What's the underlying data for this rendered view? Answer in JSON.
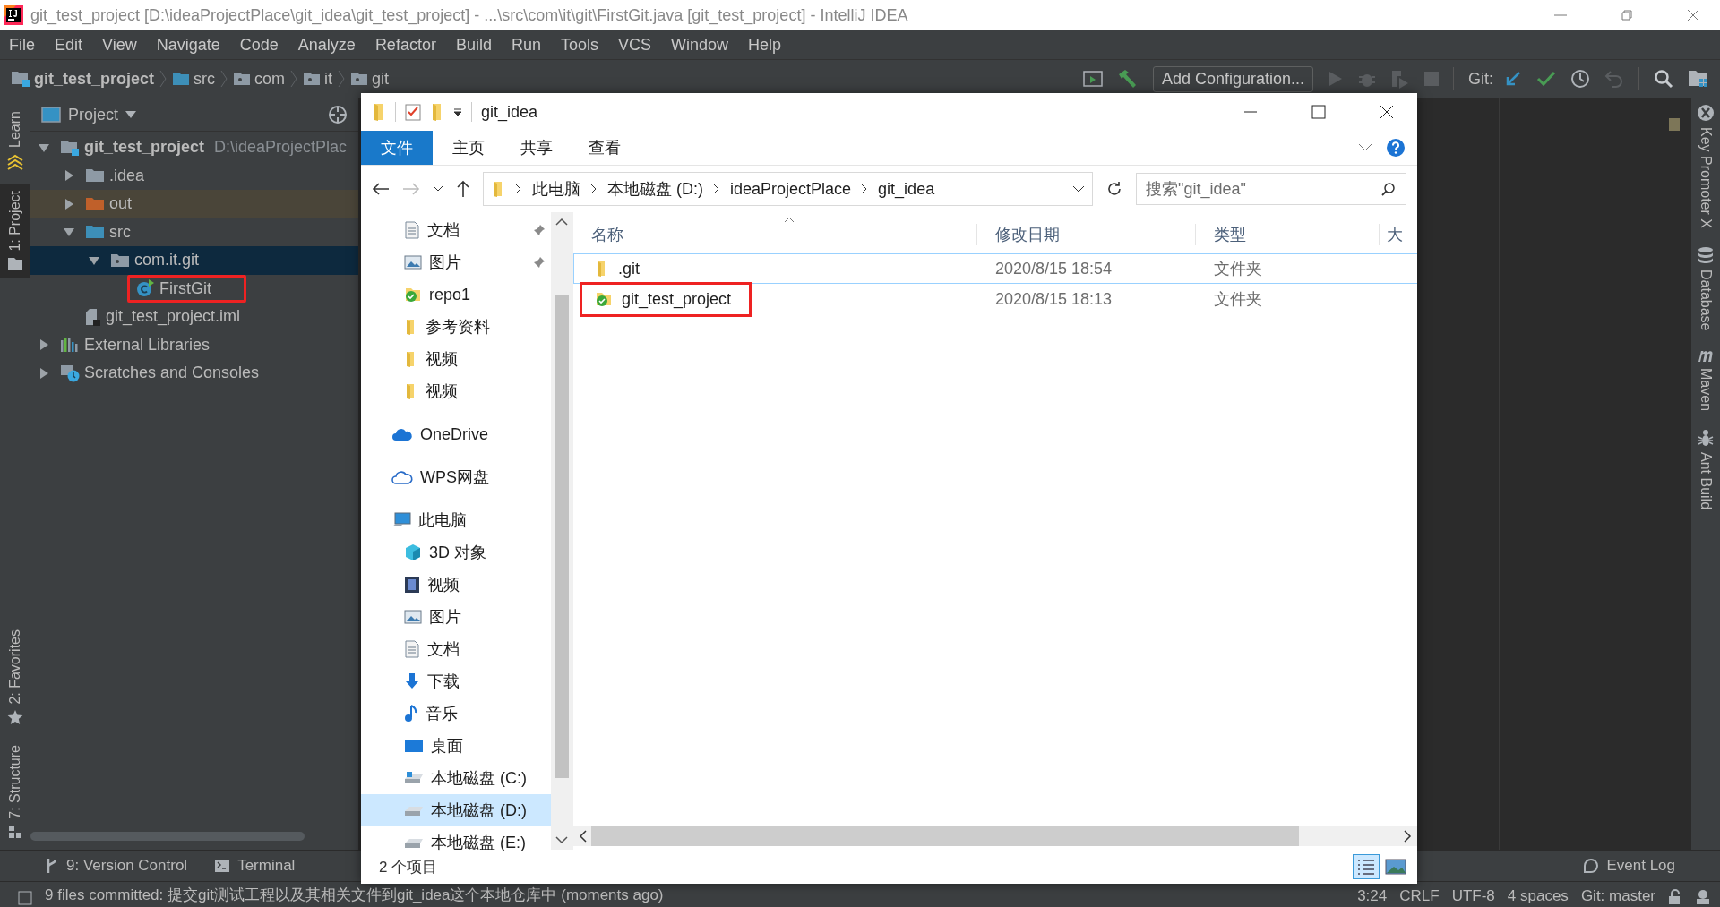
{
  "ide": {
    "title": "git_test_project [D:\\ideaProjectPlace\\git_idea\\git_test_project] - ...\\src\\com\\it\\git\\FirstGit.java [git_test_project] - IntelliJ IDEA",
    "menu": [
      "File",
      "Edit",
      "View",
      "Navigate",
      "Code",
      "Analyze",
      "Refactor",
      "Build",
      "Run",
      "Tools",
      "VCS",
      "Window",
      "Help"
    ],
    "breadcrumb": [
      {
        "label": "git_test_project",
        "kind": "module"
      },
      {
        "label": "src",
        "kind": "source"
      },
      {
        "label": "com",
        "kind": "package"
      },
      {
        "label": "it",
        "kind": "package"
      },
      {
        "label": "git",
        "kind": "package"
      }
    ],
    "run_config": "Add Configuration...",
    "git_label": "Git:",
    "left_stripe": [
      {
        "label": "Learn",
        "kind": "learn",
        "selected": false
      },
      {
        "label": "1: Project",
        "kind": "project",
        "selected": true
      },
      {
        "label": "2: Favorites",
        "kind": "favorites",
        "selected": false
      },
      {
        "label": "7: Structure",
        "kind": "structure",
        "selected": false
      }
    ],
    "project_panel": {
      "title": "Project",
      "tree": [
        {
          "label": "git_test_project",
          "note": "D:\\ideaProjectPlac",
          "kind": "module",
          "expanded": true,
          "selected": false,
          "boxed": false,
          "children": [
            {
              "label": ".idea",
              "kind": "folder",
              "expanded": false,
              "selected": false,
              "boxed": false
            },
            {
              "label": "out",
              "kind": "excluded",
              "expanded": false,
              "selected": false,
              "boxed": false
            },
            {
              "label": "src",
              "kind": "source",
              "expanded": true,
              "selected": false,
              "boxed": false,
              "children": [
                {
                  "label": "com.it.git",
                  "kind": "package",
                  "expanded": true,
                  "selected": true,
                  "boxed": false,
                  "children": [
                    {
                      "label": "FirstGit",
                      "kind": "class",
                      "selected": false,
                      "boxed": true
                    }
                  ]
                }
              ]
            },
            {
              "label": "git_test_project.iml",
              "kind": "iml",
              "selected": false,
              "boxed": false
            }
          ]
        },
        {
          "label": "External Libraries",
          "kind": "libraries",
          "expanded": false,
          "selected": false,
          "boxed": false
        },
        {
          "label": "Scratches and Consoles",
          "kind": "scratches",
          "expanded": false,
          "selected": false,
          "boxed": false
        }
      ]
    },
    "right_stripe": [
      {
        "label": "Key Promoter X",
        "kind": "key"
      },
      {
        "label": "Database",
        "kind": "database"
      },
      {
        "label": "Maven",
        "kind": "maven"
      },
      {
        "label": "Ant Build",
        "kind": "ant"
      }
    ],
    "bottom_tabs": [
      {
        "label": "9: Version Control",
        "kind": "vcs"
      },
      {
        "label": "Terminal",
        "kind": "terminal"
      }
    ],
    "event_log": "Event Log",
    "status_bar": {
      "message": "9 files committed: 提交git测试工程以及其相关文件到git_idea这个本地仓库中 (moments ago)",
      "items": [
        "3:24",
        "CRLF",
        "UTF-8",
        "4 spaces",
        "Git: master"
      ]
    }
  },
  "explorer": {
    "title": "git_idea",
    "ribbon_tabs": [
      {
        "label": "文件",
        "selected": true
      },
      {
        "label": "主页",
        "selected": false
      },
      {
        "label": "共享",
        "selected": false
      },
      {
        "label": "查看",
        "selected": false
      }
    ],
    "address": [
      "此电脑",
      "本地磁盘 (D:)",
      "ideaProjectPlace",
      "git_idea"
    ],
    "search": {
      "placeholder": "搜索\"git_idea\""
    },
    "quick_access": [
      {
        "label": "文档",
        "kind": "doc",
        "pinned": true,
        "selected": false
      },
      {
        "label": "图片",
        "kind": "pictures",
        "pinned": true,
        "selected": false
      },
      {
        "label": "repo1",
        "kind": "repo",
        "pinned": false,
        "selected": false
      },
      {
        "label": "参考资料",
        "kind": "folder",
        "pinned": false,
        "selected": false
      },
      {
        "label": "视频",
        "kind": "folder",
        "pinned": false,
        "selected": false
      },
      {
        "label": "视频",
        "kind": "folder",
        "pinned": false,
        "selected": false
      }
    ],
    "nav": [
      {
        "label": "OneDrive",
        "kind": "onedrive",
        "selected": false
      },
      {
        "label": "WPS网盘",
        "kind": "wps",
        "selected": false
      },
      {
        "label": "此电脑",
        "kind": "pc",
        "selected": false,
        "children": [
          {
            "label": "3D 对象",
            "kind": "cube",
            "selected": false
          },
          {
            "label": "视频",
            "kind": "video",
            "selected": false
          },
          {
            "label": "图片",
            "kind": "pictures",
            "selected": false
          },
          {
            "label": "文档",
            "kind": "doc",
            "selected": false
          },
          {
            "label": "下载",
            "kind": "download",
            "selected": false
          },
          {
            "label": "音乐",
            "kind": "music",
            "selected": false
          },
          {
            "label": "桌面",
            "kind": "desktop",
            "selected": false
          },
          {
            "label": "本地磁盘 (C:)",
            "kind": "drive_c",
            "selected": false
          },
          {
            "label": "本地磁盘 (D:)",
            "kind": "drive",
            "selected": true
          },
          {
            "label": "本地磁盘 (E:)",
            "kind": "drive",
            "selected": false
          }
        ]
      }
    ],
    "columns": [
      "名称",
      "修改日期",
      "类型",
      "大"
    ],
    "rows": [
      {
        "name": ".git",
        "kind": "folder",
        "date": "2020/8/15 18:54",
        "type": "文件夹",
        "focused": true,
        "boxed": false
      },
      {
        "name": "git_test_project",
        "kind": "repo",
        "date": "2020/8/15 18:13",
        "type": "文件夹",
        "focused": false,
        "boxed": true
      }
    ],
    "status": "2 个项目"
  }
}
